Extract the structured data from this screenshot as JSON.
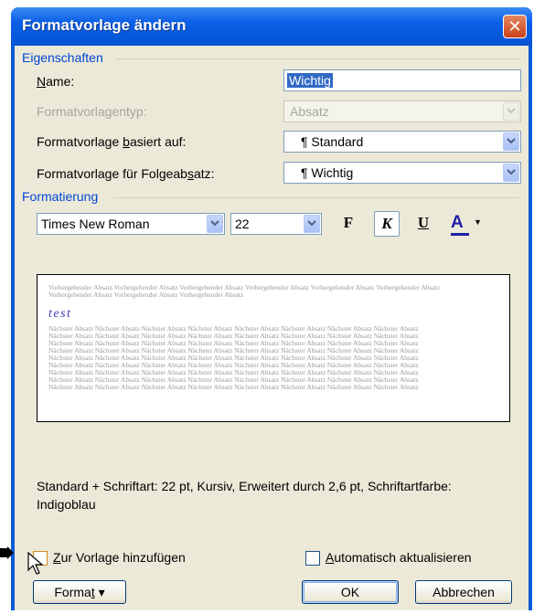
{
  "window": {
    "title": "Formatvorlage ändern"
  },
  "properties": {
    "group_label": "Eigenschaften",
    "name_label_u": "N",
    "name_label_rest": "ame:",
    "name_value": "Wichtig",
    "type_label": "Formatvorlagentyp:",
    "type_value": "Absatz",
    "based_on_label_pre": "Formatvorlage ",
    "based_on_label_u": "b",
    "based_on_label_post": "asiert auf:",
    "based_on_value": "¶ Standard",
    "next_label_pre": "Formatvorlage für Folgeab",
    "next_label_u": "s",
    "next_label_post": "atz:",
    "next_value": "¶ Wichtig"
  },
  "formatting": {
    "group_label": "Formatierung",
    "font": "Times New Roman",
    "size": "22",
    "bold": "F",
    "italic": "K",
    "underline": "U",
    "font_color_letter": "A"
  },
  "preview": {
    "previous_text": "Vorhergehender Absatz Vorhergehender Absatz Vorhergehender Absatz Vorhergehender Absatz Vorhergehender Absatz Vorhergehender Absatz Vorhergehender Absatz Vorhergehender Absatz Vorhergehender Absatz",
    "sample_text": "test",
    "next_line": "Nächster Absatz Nächster Absatz Nächster Absatz Nächster Absatz Nächster Absatz Nächster Absatz Nächster Absatz Nächster Absatz"
  },
  "description": "Standard + Schriftart: 22 pt, Kursiv, Erweitert durch  2,6 pt, Schriftartfarbe: Indigoblau",
  "options": {
    "add_to_template_u": "Z",
    "add_to_template_rest": "ur Vorlage hinzufügen",
    "auto_update_u": "A",
    "auto_update_rest": "utomatisch aktualisieren"
  },
  "buttons": {
    "format_pre": "Forma",
    "format_u": "t",
    "format_arrow": "▾",
    "ok": "OK",
    "cancel": "Abbrechen"
  },
  "colors": {
    "font_color_bar": "#1f1fa8",
    "group_label": "#0046d5",
    "titlebar": "#0a5ee6"
  }
}
